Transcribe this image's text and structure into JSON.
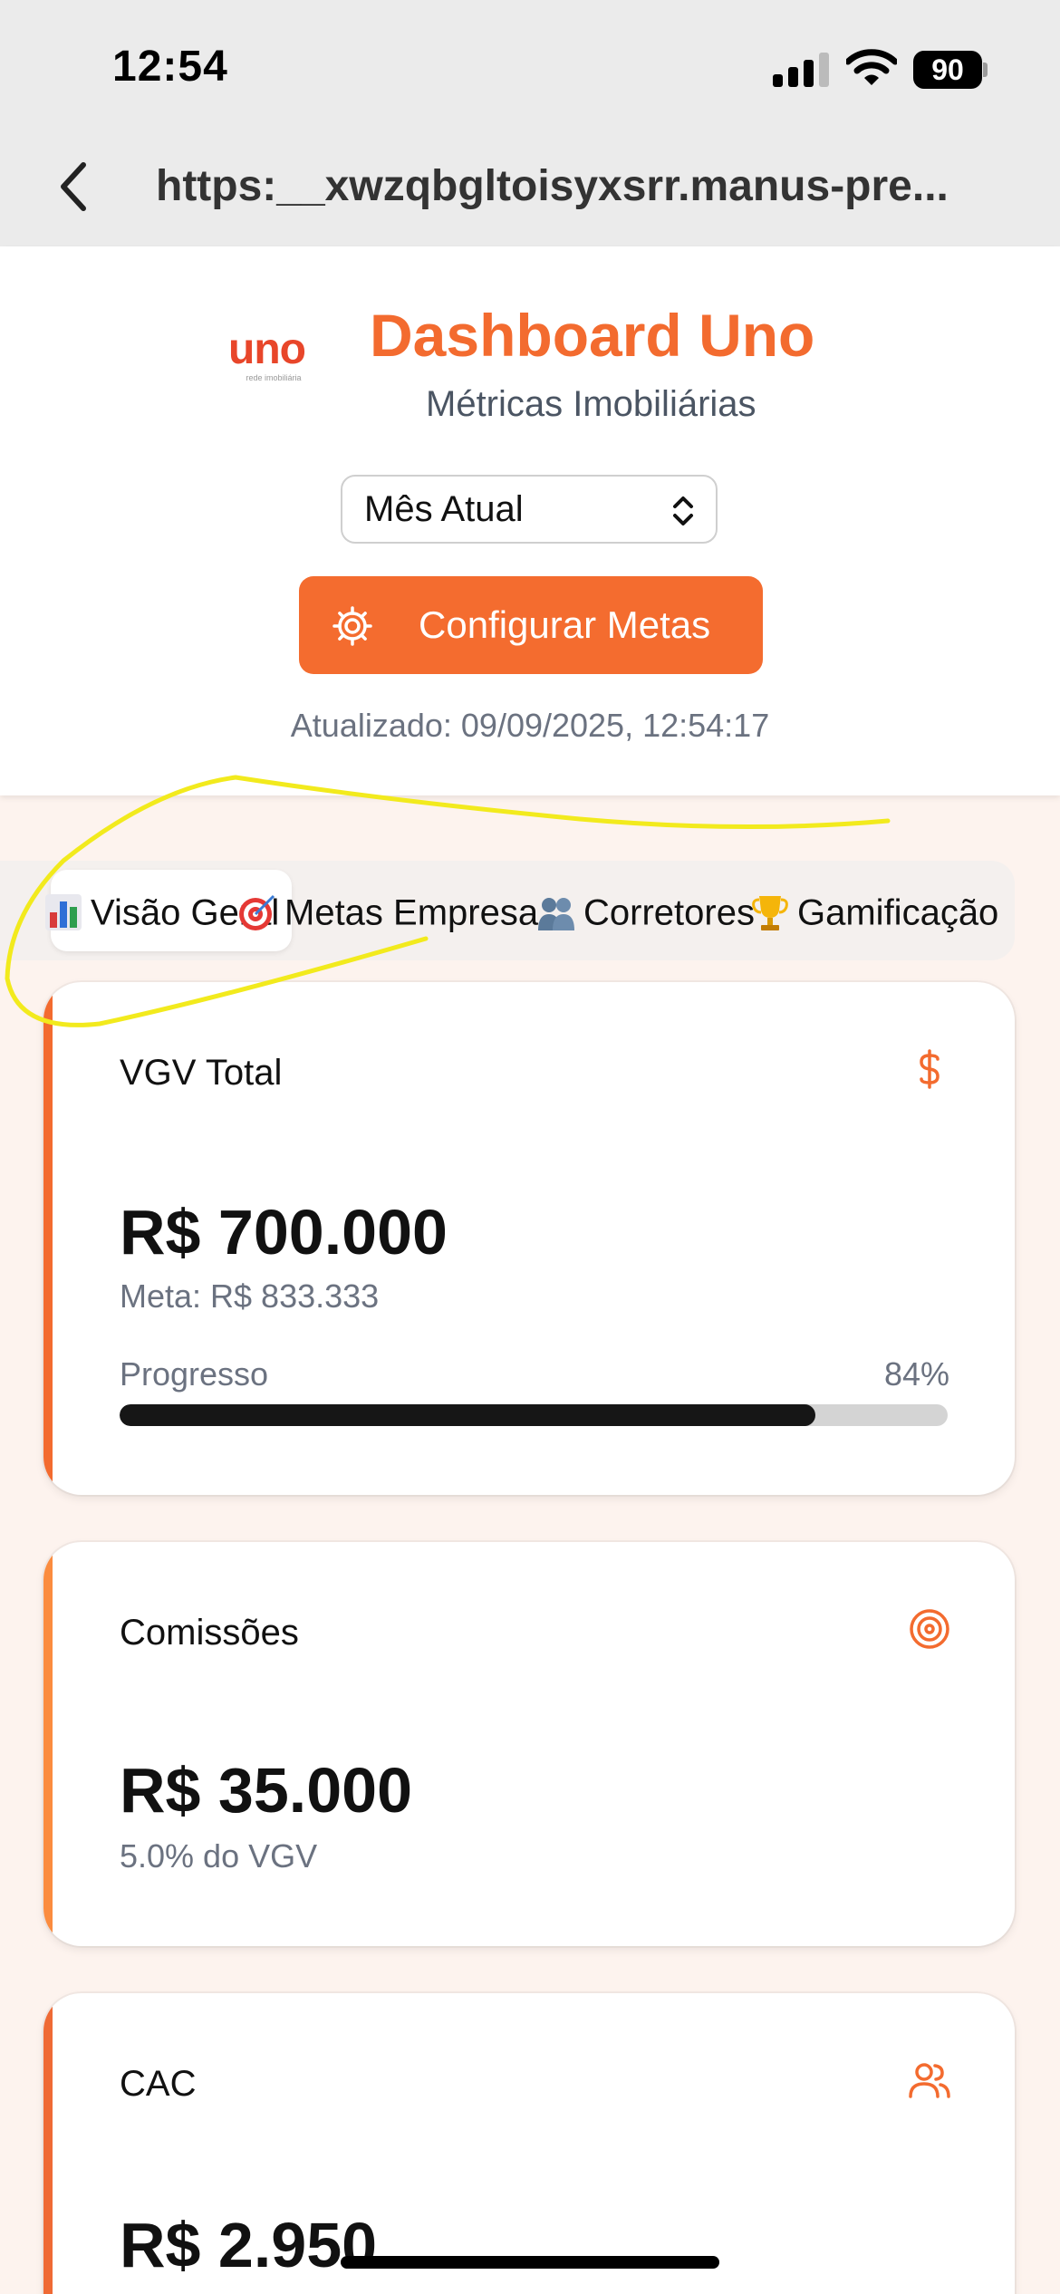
{
  "status_bar": {
    "time": "12:54",
    "battery": "90"
  },
  "browser": {
    "url": "https:__xwzqbgltoisyxsrr.manus-pre..."
  },
  "header": {
    "logo_text": "uno",
    "logo_subtext": "rede imobiliária",
    "title": "Dashboard Uno",
    "subtitle": "Métricas Imobiliárias",
    "period_select": {
      "value": "Mês Atual"
    },
    "config_button_label": "Configurar Metas",
    "updated_text": "Atualizado: 09/09/2025, 12:54:17"
  },
  "tabs": [
    {
      "label": "Visão Geral",
      "icon": "bar-chart-icon",
      "active": true
    },
    {
      "label": "Metas Empresa",
      "icon": "target-icon",
      "active": false
    },
    {
      "label": "Corretores",
      "icon": "people-icon",
      "active": false
    },
    {
      "label": "Gamificação",
      "icon": "trophy-icon",
      "active": false
    }
  ],
  "cards": {
    "vgv": {
      "title": "VGV Total",
      "icon": "dollar-icon",
      "value": "R$ 700.000",
      "subtext": "Meta: R$ 833.333",
      "progress_label": "Progresso",
      "progress_text": "84%",
      "progress_fraction": 0.84,
      "accent": "#f36b2f"
    },
    "comissoes": {
      "title": "Comissões",
      "icon": "target-icon",
      "value": "R$ 35.000",
      "subtext": "5.0% do VGV",
      "accent": "#fb8c3f"
    },
    "cac": {
      "title": "CAC",
      "icon": "users-icon",
      "value": "R$ 2.950",
      "accent": "#ef6a35"
    }
  },
  "colors": {
    "brand": "#f36b2f",
    "annotation": "#f2ea1d"
  }
}
